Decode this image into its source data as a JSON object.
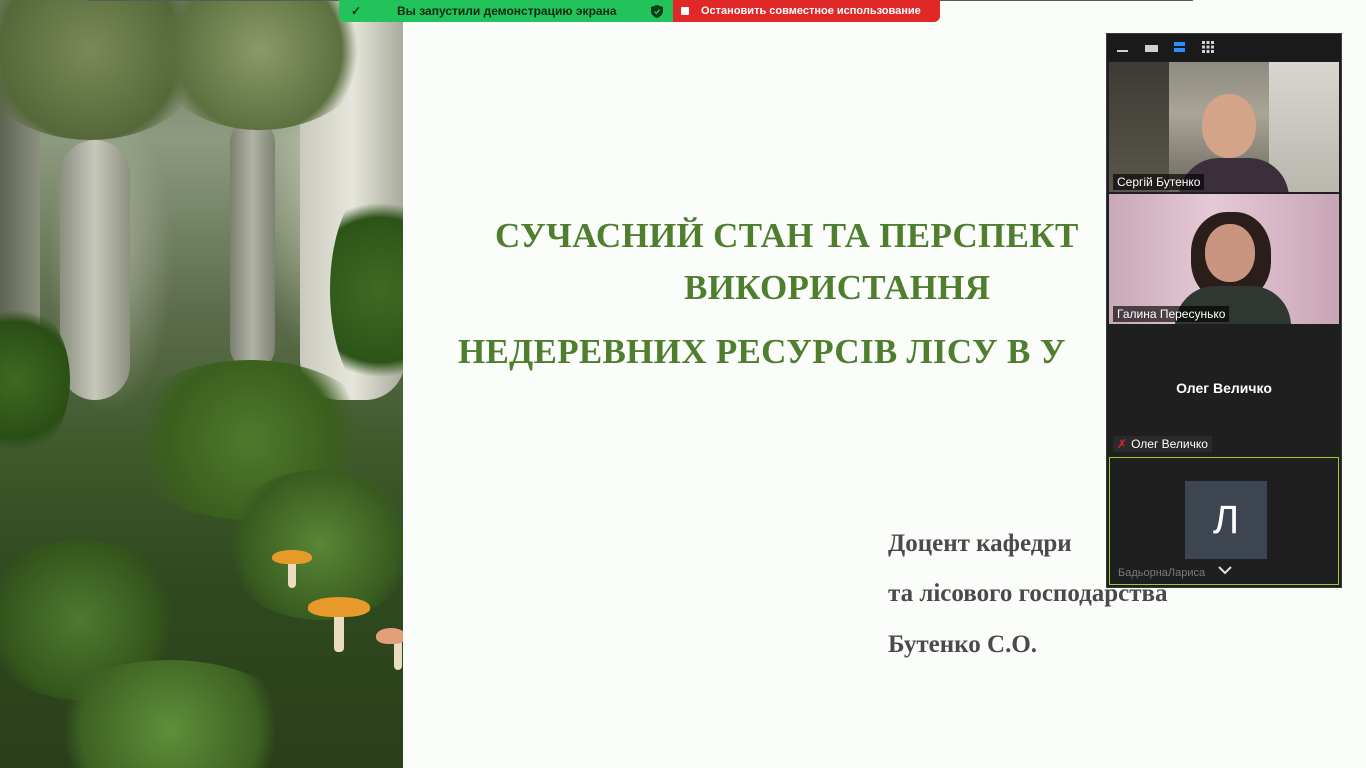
{
  "share_bar": {
    "notice": "Вы запустили демонстрацию экрана",
    "stop_label": "Остановить совместное использование"
  },
  "slide": {
    "title_line1": "СУЧАСНИЙ СТАН ТА ПЕРСПЕКТ",
    "title_line2": "ВИКОРИСТАННЯ",
    "title_line3": "НЕДЕРЕВНИХ РЕСУРСІВ ЛІСУ В У",
    "author_line1": "Доцент кафедри",
    "author_line2": "та лісового господарства",
    "author_line3": "Бутенко С.О."
  },
  "participants": [
    {
      "name": "Сергій Бутенко",
      "type": "video"
    },
    {
      "name": "Галина Пересунько",
      "type": "video"
    },
    {
      "name": "Олег Величко",
      "type": "no-video",
      "display": "Олег Величко",
      "muted": true
    },
    {
      "name": "БадьорнаЛариса",
      "type": "avatar",
      "avatar_letter": "Л",
      "active_speaker": true
    }
  ],
  "colors": {
    "slide_title": "#4e7e2e",
    "share_green": "#22c35a",
    "share_red": "#e02828",
    "active_speaker_border": "#9acd32",
    "toolbar_active": "#2d8cff"
  },
  "icons": {
    "notice_icon": "pin-icon",
    "shield": "security-shield-icon",
    "stop": "stop-square-icon",
    "toolbar": [
      "minimize-icon",
      "hide-video-icon",
      "speaker-view-icon",
      "gallery-view-icon"
    ],
    "more": "chevron-down-icon",
    "muted": "muted-mic-icon"
  }
}
